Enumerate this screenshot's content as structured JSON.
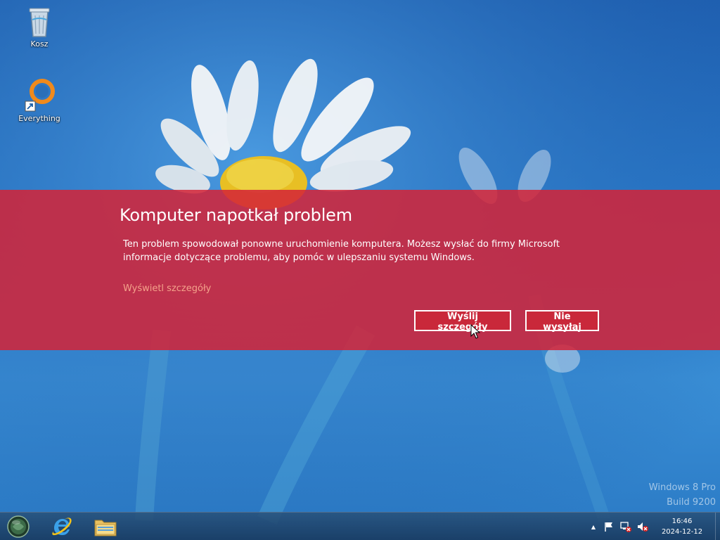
{
  "desktop": {
    "icons": [
      {
        "label": "Kosz",
        "icon": "recycle-bin-icon"
      },
      {
        "label": "Everything",
        "icon": "everything-search-icon"
      }
    ]
  },
  "error_dialog": {
    "title": "Komputer napotkał problem",
    "message": "Ten problem spowodował ponowne uruchomienie komputera. Możesz wysłać do firmy Microsoft informacje dotyczące problemu, aby pomóc w ulepszaniu systemu Windows.",
    "details_link": "Wyświetl szczegóły",
    "send_button": "Wyślij szczegóły",
    "dont_send_button": "Nie wysyłaj",
    "band_color": "#d42337"
  },
  "watermark": {
    "line1": "Windows 8 Pro",
    "line2": "Build 9200"
  },
  "taskbar": {
    "pinned": [
      {
        "icon": "start-orb-icon"
      },
      {
        "icon": "internet-explorer-icon"
      },
      {
        "icon": "file-explorer-icon"
      }
    ],
    "tray": {
      "chevron": "▲",
      "icons": [
        "action-center-flag-icon",
        "network-disconnected-icon",
        "volume-muted-icon"
      ]
    },
    "clock": {
      "time": "16:46",
      "date": "2024-12-12"
    }
  }
}
